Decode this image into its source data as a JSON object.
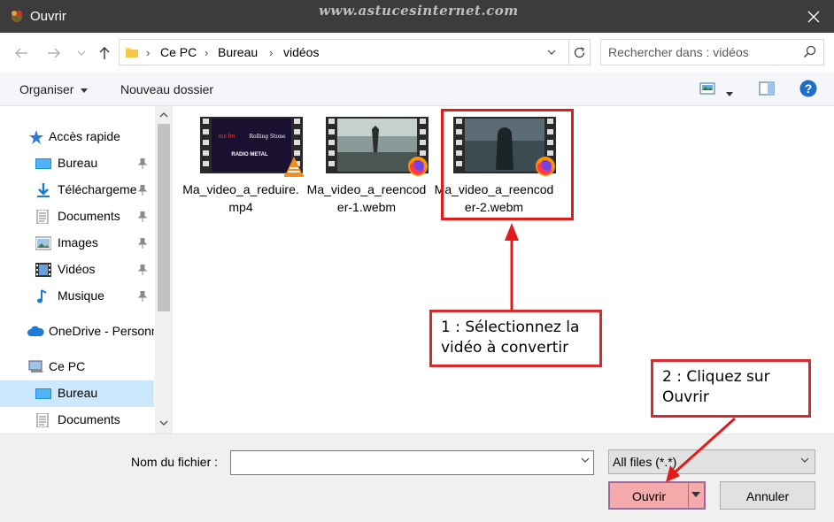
{
  "window": {
    "title": "Ouvrir",
    "watermark": "www.astucesinternet.com"
  },
  "address": {
    "crumbs": [
      "Ce PC",
      "Bureau",
      "vidéos"
    ]
  },
  "search": {
    "placeholder": "Rechercher dans : vidéos"
  },
  "toolbar": {
    "organize_label": "Organiser",
    "new_folder_label": "Nouveau dossier"
  },
  "nav": {
    "items": [
      {
        "label": "Accès rapide",
        "icon": "star-icon"
      },
      {
        "label": "Bureau",
        "icon": "desktop-icon"
      },
      {
        "label": "Téléchargements",
        "icon": "download-icon"
      },
      {
        "label": "Documents",
        "icon": "document-icon"
      },
      {
        "label": "Images",
        "icon": "image-icon"
      },
      {
        "label": "Vidéos",
        "icon": "film-icon"
      },
      {
        "label": "Musique",
        "icon": "music-icon"
      },
      {
        "label": "OneDrive - Personnel",
        "icon": "cloud-icon"
      },
      {
        "label": "Ce PC",
        "icon": "computer-icon"
      },
      {
        "label": "Bureau",
        "icon": "desktop-icon"
      },
      {
        "label": "Documents",
        "icon": "document-icon"
      }
    ]
  },
  "files": [
    {
      "name": "Ma_video_a_reduire.mp4",
      "badge": "vlc-icon",
      "thumb_text": [
        "oui fm",
        "Rolling Stone",
        "RADIO METAL"
      ]
    },
    {
      "name": "Ma_video_a_reencoder-1.webm",
      "badge": "firefox-icon"
    },
    {
      "name": "Ma_video_a_reencoder-2.webm",
      "badge": "firefox-icon"
    }
  ],
  "footer": {
    "filename_label": "Nom du fichier :",
    "filename_value": "",
    "filter_value": "All files (*.*)",
    "open_label": "Ouvrir",
    "cancel_label": "Annuler"
  },
  "annotations": {
    "step1": "1 : Sélectionnez la vidéo à convertir",
    "step2": "2 : Cliquez sur Ouvrir"
  },
  "colors": {
    "annotation": "#e31b1b",
    "selection": "#cce8ff",
    "open_button": "#f4aaaa",
    "titlebar": "#3c3c3c"
  }
}
